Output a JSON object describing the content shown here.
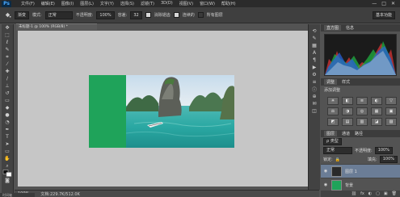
{
  "app": {
    "logo": "Ps"
  },
  "menu": [
    "文件(F)",
    "编辑(E)",
    "图像(I)",
    "图层(L)",
    "文字(Y)",
    "选择(S)",
    "滤镜(T)",
    "3D(D)",
    "视图(V)",
    "窗口(W)",
    "帮助(H)"
  ],
  "window_controls": {
    "minimize": "—",
    "maximize": "□",
    "close": "✕"
  },
  "options": {
    "preset": "渐变",
    "mode_label": "模式:",
    "mode_value": "正常",
    "opacity_label": "不透明度:",
    "opacity_value": "100%",
    "tolerance_label": "容差:",
    "tolerance_value": "32",
    "antialias": "消除锯齿",
    "contiguous": "连续的",
    "all_layers": "所有图层",
    "workspace": "基本功能"
  },
  "document": {
    "tab": "未标题-1 @ 100% (RGB/8) *",
    "zoom": "100%",
    "doc_size": "文档:229.7K/512.0K"
  },
  "timeline": "时间轴",
  "panels": {
    "histogram_tabs": [
      "直方图",
      "信息"
    ],
    "adjustments_tabs": [
      "调整",
      "样式"
    ],
    "adjustments_title": "添加调整",
    "adjustment_icons": [
      "☀",
      "◧",
      "≡",
      "◐",
      "▽",
      "⚖",
      "◑",
      "◎",
      "▦",
      "▣",
      "◩",
      "▤",
      "▥",
      "◪",
      "▨"
    ],
    "layers_tabs": [
      "图层",
      "通道",
      "路径"
    ],
    "kind_label": "ρ 类型",
    "blend_mode": "正常",
    "opacity_label": "不透明度:",
    "opacity_value": "100%",
    "lock_label": "锁定:",
    "fill_label": "填充:",
    "fill_value": "100%",
    "layers": [
      {
        "name": "图层 1",
        "selected": true
      },
      {
        "name": "背景",
        "selected": false
      }
    ],
    "footer_icons": [
      "⛓",
      "fx",
      "◐",
      "▢",
      "▣",
      "🗑"
    ]
  },
  "colors": {
    "green_fill": "#1fa35a",
    "canvas": "#c6c6c6"
  }
}
